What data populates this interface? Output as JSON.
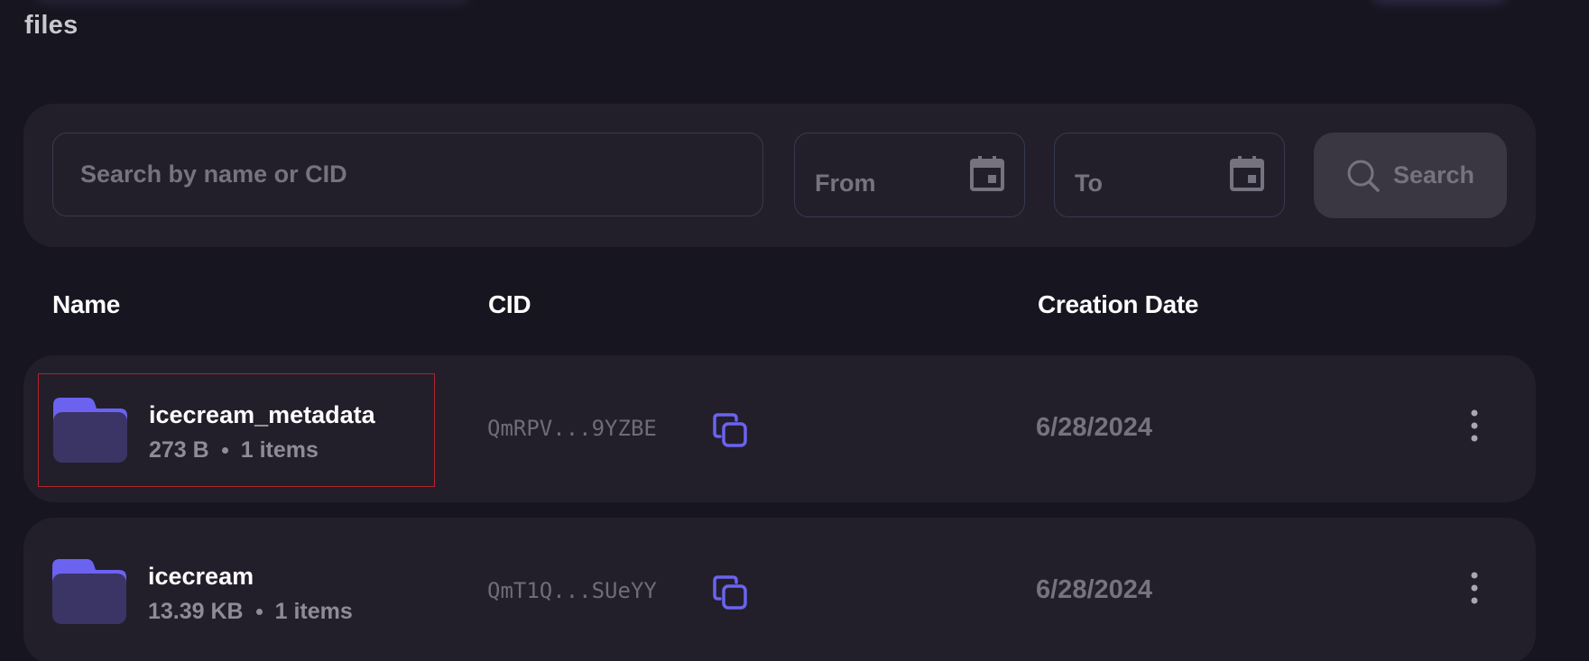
{
  "page": {
    "title": "files"
  },
  "filters": {
    "search_placeholder": "Search by name or CID",
    "from_label": "From",
    "to_label": "To",
    "search_button_label": "Search"
  },
  "table": {
    "headers": {
      "name": "Name",
      "cid": "CID",
      "creation_date": "Creation Date"
    },
    "rows": [
      {
        "name": "icecream_metadata",
        "size": "273 B",
        "items": "1 items",
        "cid": "QmRPV...9YZBE",
        "date": "6/28/2024",
        "icon": "folder-icon"
      },
      {
        "name": "icecream",
        "size": "13.39 KB",
        "items": "1 items",
        "cid": "QmT1Q...SUeYY",
        "date": "6/28/2024",
        "icon": "folder-icon"
      }
    ]
  },
  "colors": {
    "background": "#17151f",
    "panel": "#221f2b",
    "accent": "#6b63f0",
    "folder_back": "#6b63f0",
    "folder_front": "#3b3566",
    "highlight_border": "#b0242a"
  },
  "icons": [
    "calendar-icon",
    "search-icon",
    "folder-icon",
    "copy-icon",
    "more-vertical-icon"
  ]
}
